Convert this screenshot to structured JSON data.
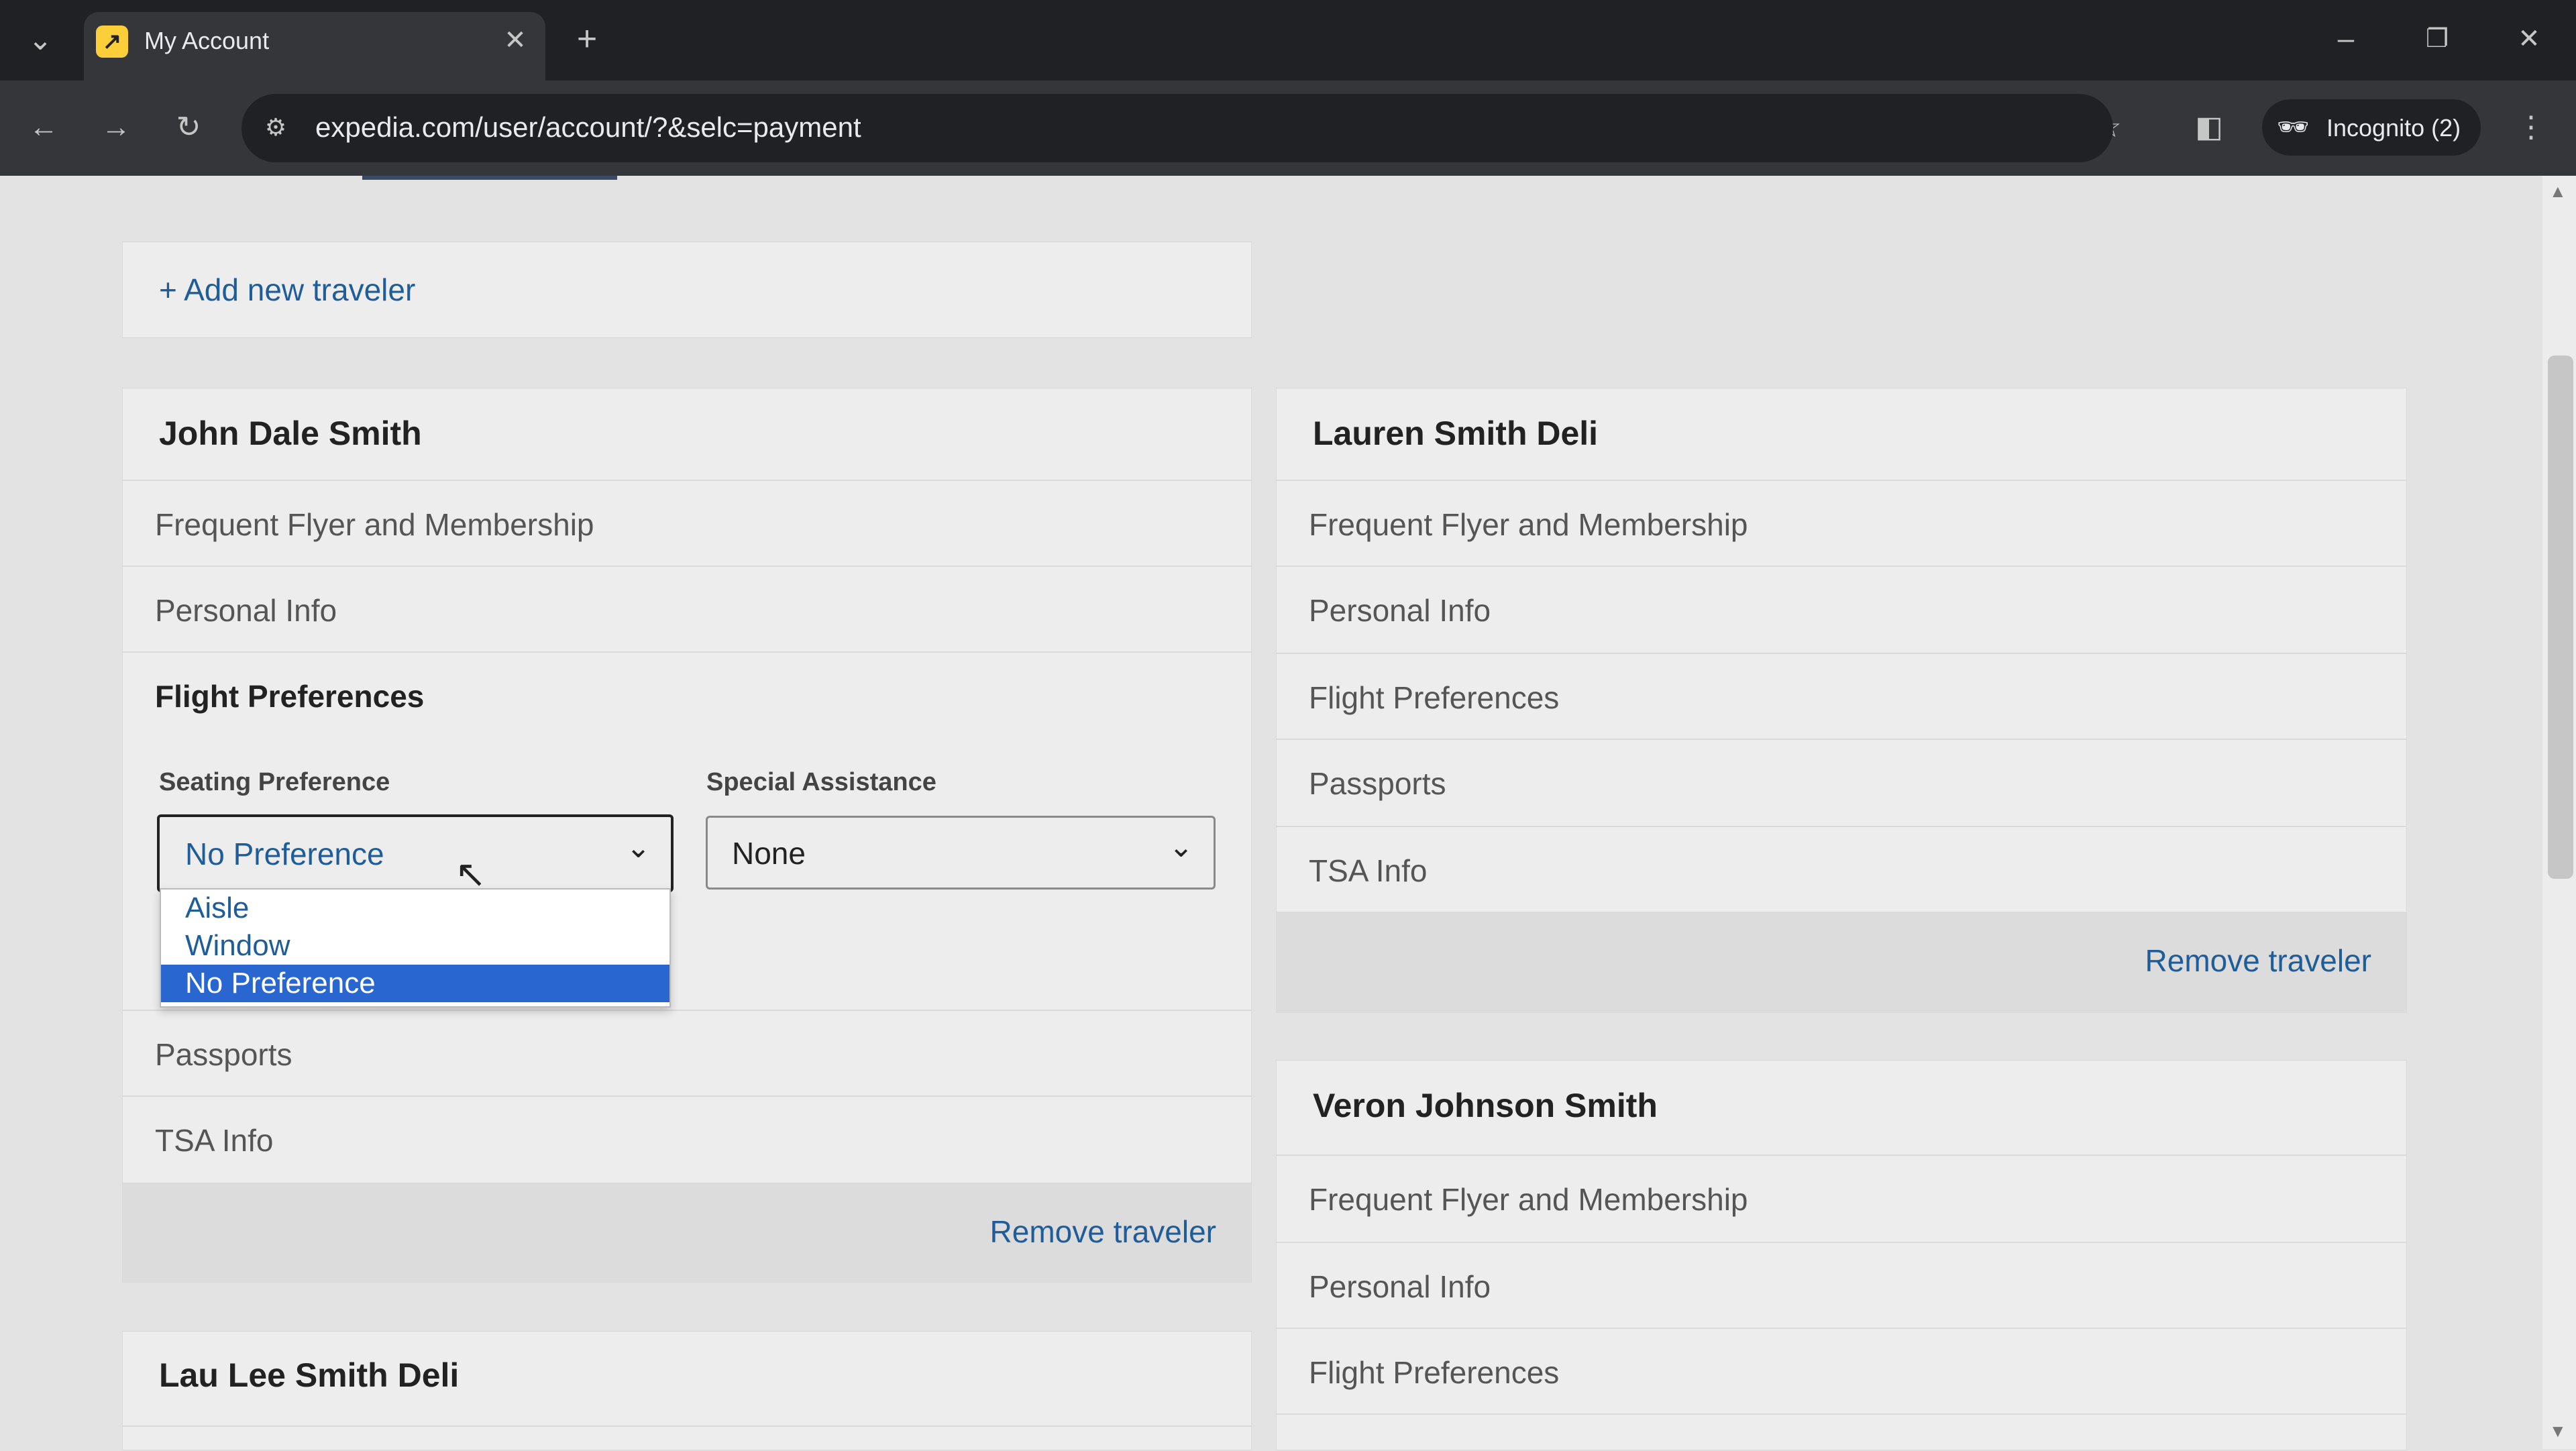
{
  "browser": {
    "tab_title": "My Account",
    "url": "expedia.com/user/account/?&selc=payment",
    "incognito_label": "Incognito (2)"
  },
  "page": {
    "add_traveler": "+ Add new traveler",
    "remove_label": "Remove traveler",
    "travelers": [
      {
        "name": "John Dale Smith",
        "sections": [
          "Frequent Flyer and Membership",
          "Personal Info",
          "Flight Preferences",
          "Passports",
          "TSA Info"
        ],
        "flight_prefs": {
          "seating_label": "Seating Preference",
          "seating_value": "No Preference",
          "assistance_label": "Special Assistance",
          "assistance_value": "None",
          "seating_options": [
            "Aisle",
            "Window",
            "No Preference"
          ]
        }
      },
      {
        "name": "Lauren Smith Deli",
        "sections": [
          "Frequent Flyer and Membership",
          "Personal Info",
          "Flight Preferences",
          "Passports",
          "TSA Info"
        ]
      },
      {
        "name": "Veron Johnson Smith",
        "sections": [
          "Frequent Flyer and Membership",
          "Personal Info",
          "Flight Preferences"
        ]
      },
      {
        "name": "Lau Lee Smith Deli",
        "sections": []
      }
    ]
  },
  "colors": {
    "link": "#1f5d9a",
    "selected_option": "#2a66d0"
  }
}
